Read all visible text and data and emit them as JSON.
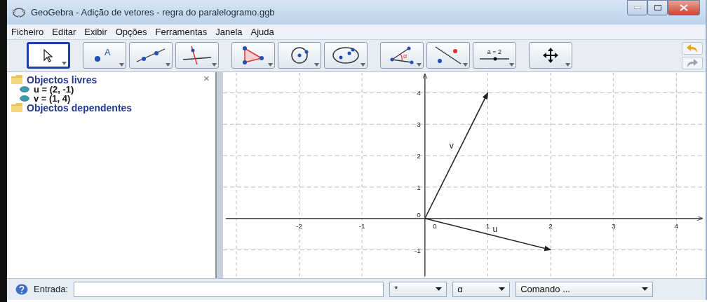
{
  "window": {
    "title": "GeoGebra - Adição de vetores - regra do paralelogramo.ggb"
  },
  "menu": [
    "Ficheiro",
    "Editar",
    "Exibir",
    "Opções",
    "Ferramentas",
    "Janela",
    "Ajuda"
  ],
  "toolbar": {
    "tools": [
      {
        "kind": "move",
        "selected": true
      },
      {
        "kind": "point",
        "selected": false,
        "label": "A"
      },
      {
        "kind": "line",
        "selected": false
      },
      {
        "kind": "perpendicular",
        "selected": false
      },
      {
        "kind": "polygon",
        "selected": false
      },
      {
        "kind": "circle",
        "selected": false
      },
      {
        "kind": "conic",
        "selected": false
      },
      {
        "kind": "angle",
        "selected": false,
        "label": "α"
      },
      {
        "kind": "reflect",
        "selected": false
      },
      {
        "kind": "slider",
        "selected": false,
        "label": "a = 2"
      },
      {
        "kind": "pan",
        "selected": false
      }
    ],
    "actions": [
      {
        "kind": "undo",
        "disabled": false
      },
      {
        "kind": "redo",
        "disabled": true
      }
    ]
  },
  "algebra": {
    "close": "×",
    "tree": [
      {
        "label": "Objectos livres",
        "children": [
          {
            "label": "u = (2, -1)"
          },
          {
            "label": "v = (1, 4)"
          }
        ]
      },
      {
        "label": "Objectos dependentes"
      }
    ]
  },
  "graphics": {
    "x_ticks": [
      "-2",
      "-1",
      "0",
      "1",
      "2",
      "3",
      "4"
    ],
    "y_ticks": [
      "4",
      "3",
      "2",
      "1",
      "0",
      "-1"
    ],
    "vectors": [
      {
        "label": "v"
      },
      {
        "label": "u"
      }
    ]
  },
  "input": {
    "label": "Entrada:",
    "dropdowns": [
      {
        "value": "*"
      },
      {
        "value": "α"
      },
      {
        "value": "Comando ..."
      }
    ]
  }
}
